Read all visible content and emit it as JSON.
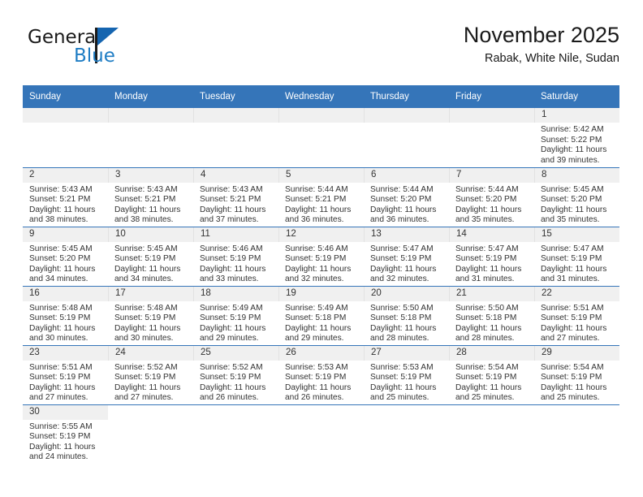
{
  "brand": {
    "name_top": "General",
    "name_bottom": "Blue",
    "accent_color": "#1f7dc4",
    "flag_color": "#1565b0"
  },
  "header": {
    "title": "November 2025",
    "subtitle": "Rabak, White Nile, Sudan"
  },
  "theme": {
    "header_blue": "#3575b9",
    "daynum_band": "#f0f0f0",
    "text": "#333333"
  },
  "calendar": {
    "weekday_headers": [
      "Sunday",
      "Monday",
      "Tuesday",
      "Wednesday",
      "Thursday",
      "Friday",
      "Saturday"
    ],
    "labels": {
      "sunrise": "Sunrise:",
      "sunset": "Sunset:",
      "daylight": "Daylight:"
    },
    "weeks": [
      [
        {
          "day": "",
          "blank": true
        },
        {
          "day": "",
          "blank": true
        },
        {
          "day": "",
          "blank": true
        },
        {
          "day": "",
          "blank": true
        },
        {
          "day": "",
          "blank": true
        },
        {
          "day": "",
          "blank": true
        },
        {
          "day": "1",
          "sunrise": "Sunrise: 5:42 AM",
          "sunset": "Sunset: 5:22 PM",
          "daylight_l1": "Daylight: 11 hours",
          "daylight_l2": "and 39 minutes."
        }
      ],
      [
        {
          "day": "2",
          "sunrise": "Sunrise: 5:43 AM",
          "sunset": "Sunset: 5:21 PM",
          "daylight_l1": "Daylight: 11 hours",
          "daylight_l2": "and 38 minutes."
        },
        {
          "day": "3",
          "sunrise": "Sunrise: 5:43 AM",
          "sunset": "Sunset: 5:21 PM",
          "daylight_l1": "Daylight: 11 hours",
          "daylight_l2": "and 38 minutes."
        },
        {
          "day": "4",
          "sunrise": "Sunrise: 5:43 AM",
          "sunset": "Sunset: 5:21 PM",
          "daylight_l1": "Daylight: 11 hours",
          "daylight_l2": "and 37 minutes."
        },
        {
          "day": "5",
          "sunrise": "Sunrise: 5:44 AM",
          "sunset": "Sunset: 5:21 PM",
          "daylight_l1": "Daylight: 11 hours",
          "daylight_l2": "and 36 minutes."
        },
        {
          "day": "6",
          "sunrise": "Sunrise: 5:44 AM",
          "sunset": "Sunset: 5:20 PM",
          "daylight_l1": "Daylight: 11 hours",
          "daylight_l2": "and 36 minutes."
        },
        {
          "day": "7",
          "sunrise": "Sunrise: 5:44 AM",
          "sunset": "Sunset: 5:20 PM",
          "daylight_l1": "Daylight: 11 hours",
          "daylight_l2": "and 35 minutes."
        },
        {
          "day": "8",
          "sunrise": "Sunrise: 5:45 AM",
          "sunset": "Sunset: 5:20 PM",
          "daylight_l1": "Daylight: 11 hours",
          "daylight_l2": "and 35 minutes."
        }
      ],
      [
        {
          "day": "9",
          "sunrise": "Sunrise: 5:45 AM",
          "sunset": "Sunset: 5:20 PM",
          "daylight_l1": "Daylight: 11 hours",
          "daylight_l2": "and 34 minutes."
        },
        {
          "day": "10",
          "sunrise": "Sunrise: 5:45 AM",
          "sunset": "Sunset: 5:19 PM",
          "daylight_l1": "Daylight: 11 hours",
          "daylight_l2": "and 34 minutes."
        },
        {
          "day": "11",
          "sunrise": "Sunrise: 5:46 AM",
          "sunset": "Sunset: 5:19 PM",
          "daylight_l1": "Daylight: 11 hours",
          "daylight_l2": "and 33 minutes."
        },
        {
          "day": "12",
          "sunrise": "Sunrise: 5:46 AM",
          "sunset": "Sunset: 5:19 PM",
          "daylight_l1": "Daylight: 11 hours",
          "daylight_l2": "and 32 minutes."
        },
        {
          "day": "13",
          "sunrise": "Sunrise: 5:47 AM",
          "sunset": "Sunset: 5:19 PM",
          "daylight_l1": "Daylight: 11 hours",
          "daylight_l2": "and 32 minutes."
        },
        {
          "day": "14",
          "sunrise": "Sunrise: 5:47 AM",
          "sunset": "Sunset: 5:19 PM",
          "daylight_l1": "Daylight: 11 hours",
          "daylight_l2": "and 31 minutes."
        },
        {
          "day": "15",
          "sunrise": "Sunrise: 5:47 AM",
          "sunset": "Sunset: 5:19 PM",
          "daylight_l1": "Daylight: 11 hours",
          "daylight_l2": "and 31 minutes."
        }
      ],
      [
        {
          "day": "16",
          "sunrise": "Sunrise: 5:48 AM",
          "sunset": "Sunset: 5:19 PM",
          "daylight_l1": "Daylight: 11 hours",
          "daylight_l2": "and 30 minutes."
        },
        {
          "day": "17",
          "sunrise": "Sunrise: 5:48 AM",
          "sunset": "Sunset: 5:19 PM",
          "daylight_l1": "Daylight: 11 hours",
          "daylight_l2": "and 30 minutes."
        },
        {
          "day": "18",
          "sunrise": "Sunrise: 5:49 AM",
          "sunset": "Sunset: 5:19 PM",
          "daylight_l1": "Daylight: 11 hours",
          "daylight_l2": "and 29 minutes."
        },
        {
          "day": "19",
          "sunrise": "Sunrise: 5:49 AM",
          "sunset": "Sunset: 5:18 PM",
          "daylight_l1": "Daylight: 11 hours",
          "daylight_l2": "and 29 minutes."
        },
        {
          "day": "20",
          "sunrise": "Sunrise: 5:50 AM",
          "sunset": "Sunset: 5:18 PM",
          "daylight_l1": "Daylight: 11 hours",
          "daylight_l2": "and 28 minutes."
        },
        {
          "day": "21",
          "sunrise": "Sunrise: 5:50 AM",
          "sunset": "Sunset: 5:18 PM",
          "daylight_l1": "Daylight: 11 hours",
          "daylight_l2": "and 28 minutes."
        },
        {
          "day": "22",
          "sunrise": "Sunrise: 5:51 AM",
          "sunset": "Sunset: 5:19 PM",
          "daylight_l1": "Daylight: 11 hours",
          "daylight_l2": "and 27 minutes."
        }
      ],
      [
        {
          "day": "23",
          "sunrise": "Sunrise: 5:51 AM",
          "sunset": "Sunset: 5:19 PM",
          "daylight_l1": "Daylight: 11 hours",
          "daylight_l2": "and 27 minutes."
        },
        {
          "day": "24",
          "sunrise": "Sunrise: 5:52 AM",
          "sunset": "Sunset: 5:19 PM",
          "daylight_l1": "Daylight: 11 hours",
          "daylight_l2": "and 27 minutes."
        },
        {
          "day": "25",
          "sunrise": "Sunrise: 5:52 AM",
          "sunset": "Sunset: 5:19 PM",
          "daylight_l1": "Daylight: 11 hours",
          "daylight_l2": "and 26 minutes."
        },
        {
          "day": "26",
          "sunrise": "Sunrise: 5:53 AM",
          "sunset": "Sunset: 5:19 PM",
          "daylight_l1": "Daylight: 11 hours",
          "daylight_l2": "and 26 minutes."
        },
        {
          "day": "27",
          "sunrise": "Sunrise: 5:53 AM",
          "sunset": "Sunset: 5:19 PM",
          "daylight_l1": "Daylight: 11 hours",
          "daylight_l2": "and 25 minutes."
        },
        {
          "day": "28",
          "sunrise": "Sunrise: 5:54 AM",
          "sunset": "Sunset: 5:19 PM",
          "daylight_l1": "Daylight: 11 hours",
          "daylight_l2": "and 25 minutes."
        },
        {
          "day": "29",
          "sunrise": "Sunrise: 5:54 AM",
          "sunset": "Sunset: 5:19 PM",
          "daylight_l1": "Daylight: 11 hours",
          "daylight_l2": "and 25 minutes."
        }
      ],
      [
        {
          "day": "30",
          "sunrise": "Sunrise: 5:55 AM",
          "sunset": "Sunset: 5:19 PM",
          "daylight_l1": "Daylight: 11 hours",
          "daylight_l2": "and 24 minutes."
        },
        {
          "day": "",
          "blank": true,
          "last": true
        },
        {
          "day": "",
          "blank": true,
          "last": true
        },
        {
          "day": "",
          "blank": true,
          "last": true
        },
        {
          "day": "",
          "blank": true,
          "last": true
        },
        {
          "day": "",
          "blank": true,
          "last": true
        },
        {
          "day": "",
          "blank": true,
          "last": true
        }
      ]
    ]
  }
}
